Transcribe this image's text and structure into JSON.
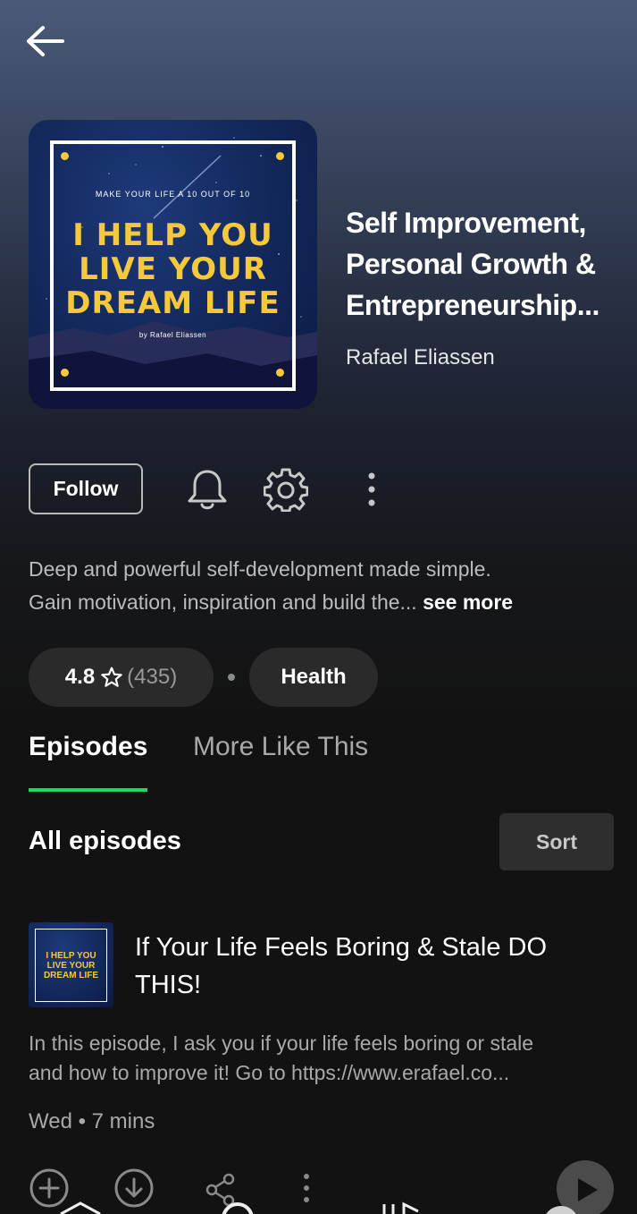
{
  "header": {
    "back_icon": "arrow-left-icon"
  },
  "podcast": {
    "cover": {
      "tagline": "MAKE YOUR LIFE A 10 OUT OF 10",
      "headline_1": "I HELP YOU",
      "headline_2": "LIVE YOUR",
      "headline_3": "DREAM LIFE",
      "byline": "by Rafael Eliassen",
      "accent_color": "#f6c83c"
    },
    "title_line_1": "Self Improvement,",
    "title_line_2": "Personal Growth &",
    "title_line_3": "Entrepreneurship...",
    "author": "Rafael Eliassen"
  },
  "actions": {
    "follow_label": "Follow",
    "bell_icon": "bell-icon",
    "settings_icon": "gear-icon",
    "more_icon": "more-vertical-icon"
  },
  "description": {
    "line_1": "Deep and powerful self-development made simple.",
    "line_2": "Gain motivation, inspiration and build the... ",
    "see_more": "see more"
  },
  "meta": {
    "rating": "4.8",
    "star_icon": "star-outline-icon",
    "rating_count": "(435)",
    "genre": "Health"
  },
  "tabs": {
    "episodes": "Episodes",
    "more_like_this": "More Like This",
    "active_color": "#1ed760"
  },
  "episodes_section": {
    "title": "All episodes",
    "sort_label": "Sort"
  },
  "episode": {
    "thumb_line_1": "I HELP YOU",
    "thumb_line_2": "LIVE YOUR",
    "thumb_line_3": "DREAM LIFE",
    "title_line_1": "If Your Life Feels Boring & Stale DO",
    "title_line_2": "THIS!",
    "desc_line_1": "In this episode, I ask you if your life feels boring or stale",
    "desc_line_2": "and how to improve it! Go to https://www.erafael.co...",
    "meta": "Wed • 7 mins",
    "action_icons": [
      "add-circle-icon",
      "download-circle-icon",
      "share-icon",
      "more-vertical-icon",
      "play-icon"
    ]
  }
}
